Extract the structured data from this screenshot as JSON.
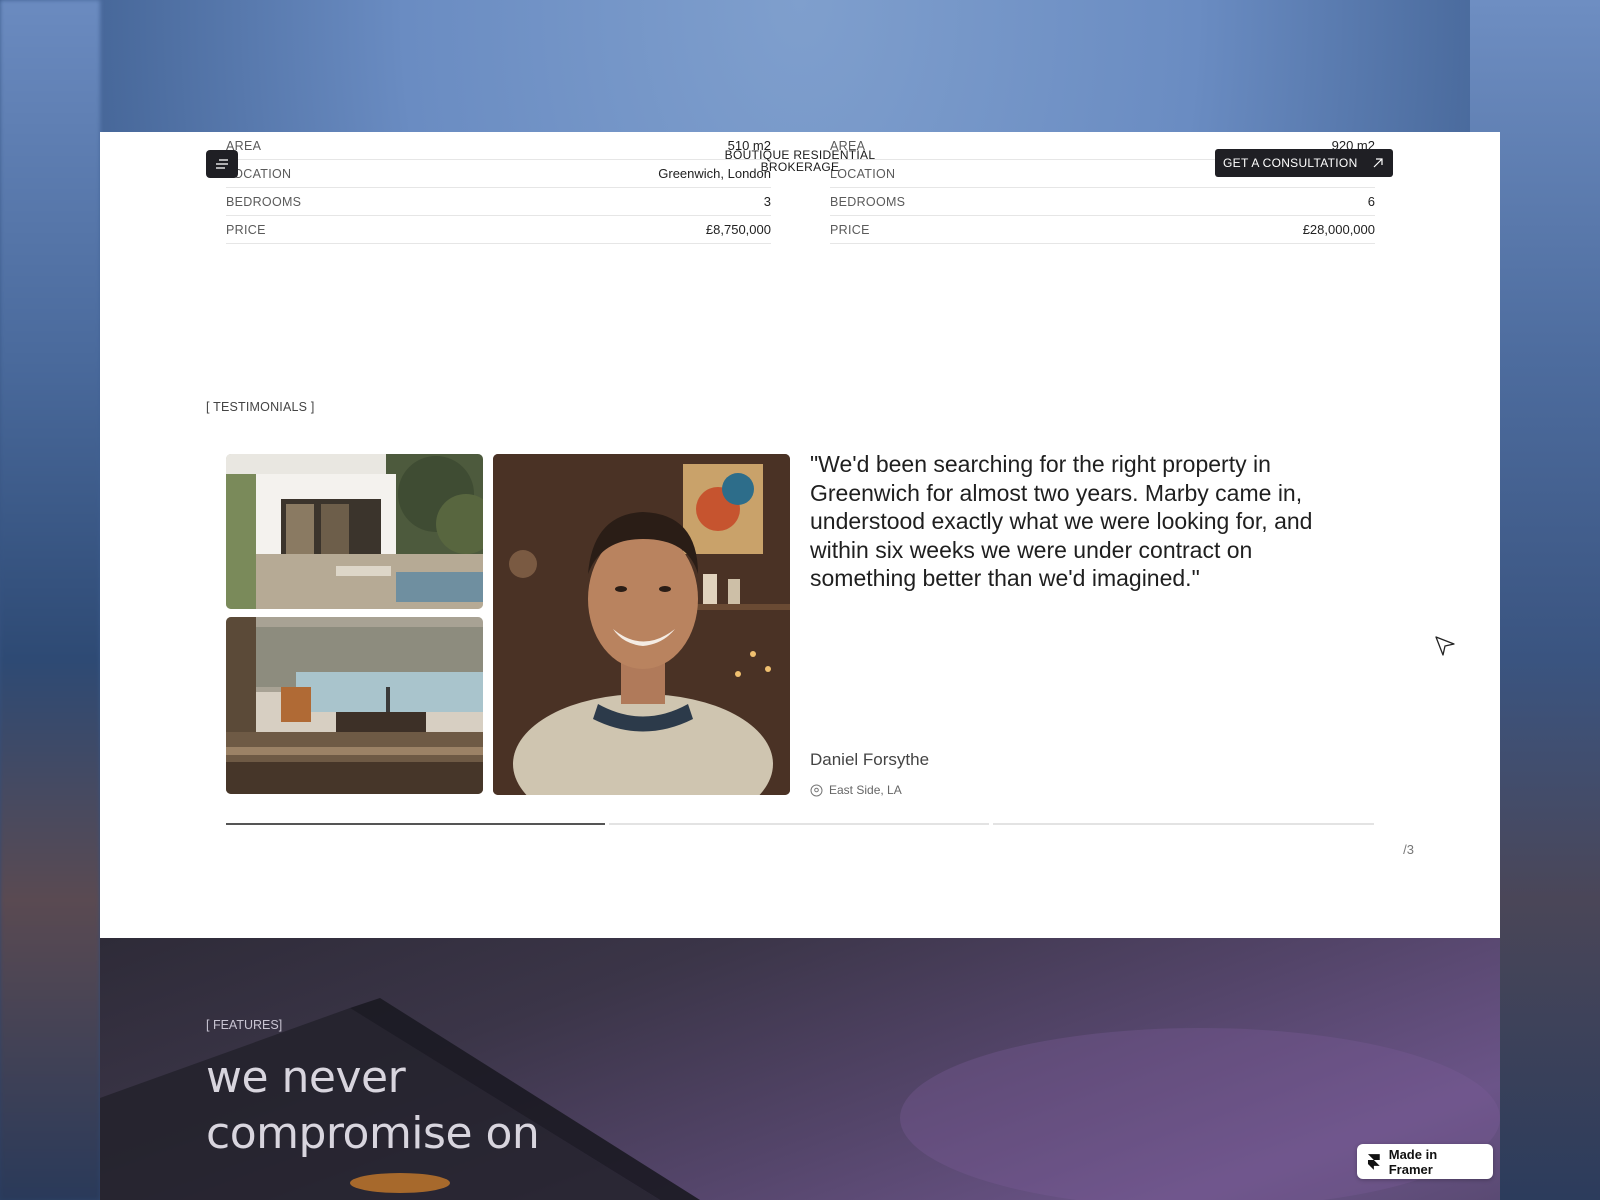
{
  "header": {
    "brand_line1": "BOUTIQUE RESIDENTIAL",
    "brand_line2": "BROKERAGE",
    "cta_label": "GET A CONSULTATION"
  },
  "properties": [
    {
      "rows": [
        {
          "k": "AREA",
          "v": "510 m2"
        },
        {
          "k": "LOCATION",
          "v": "Greenwich, London"
        },
        {
          "k": "BEDROOMS",
          "v": "3"
        },
        {
          "k": "PRICE",
          "v": "£8,750,000"
        }
      ]
    },
    {
      "rows": [
        {
          "k": "AREA",
          "v": "920 m2"
        },
        {
          "k": "LOCATION",
          "v": ""
        },
        {
          "k": "BEDROOMS",
          "v": "6"
        },
        {
          "k": "PRICE",
          "v": "£28,000,000"
        }
      ]
    }
  ],
  "testimonials": {
    "tag": "[ TESTIMONIALS ]",
    "quote": "\"We'd been searching for the right property in Greenwich for almost two years. Marby came in, understood exactly what we were looking for, and within six weeks we were under contract on something better than we'd imagined.\"",
    "author": "Daniel Forsythe",
    "location": "East Side, LA",
    "pager": "/3",
    "progress": 0.33
  },
  "features": {
    "tag": "[ FEATURES]",
    "title_line1": "we never",
    "title_line2": "compromise on"
  },
  "badge": {
    "label": "Made in Framer"
  }
}
